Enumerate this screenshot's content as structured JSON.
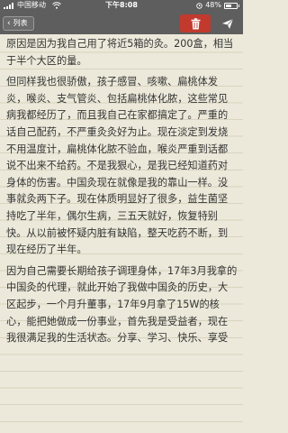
{
  "status_bar": {
    "carrier": "中国移动",
    "time": "下午8:08",
    "battery": "48%"
  },
  "nav": {
    "back_label": "列表",
    "back_icon": "chevron-left-icon",
    "delete_icon": "trash-icon",
    "share_icon": "send-icon"
  },
  "colors": {
    "toolbar": "#5e5e5e",
    "delete": "#c23a2e",
    "paper": "#ece9da"
  },
  "note": {
    "paragraphs": [
      "原因是因为我自己用了将近5箱的灸。200盒，相当于半个大区的量。",
      "但同样我也很骄傲，孩子感冒、咳嗽、扁桃体发炎，喉炎、支气管炎、包括扁桃体化脓，这些常见病我都经历了，而且我自己在家都搞定了。严重的话自己配药，不严重灸灸好为止。现在淡定到发烧不用温度计，扁桃体化脓不验血，喉炎严重到话都说不出来不给药。不是我狠心，是我已经知道药对身体的伤害。中国灸现在就像是我的靠山一样。没事就灸两下子。现在体质明显好了很多，益生菌坚持吃了半年，偶尔生病，三五天就好，恢复特别快。从以前被怀疑内脏有缺陷，整天吃药不断，到现在经历了半年。",
      "因为自己需要长期给孩子调理身体，17年3月我拿的中国灸的代理，就此开始了我做中国灸的历史，大区起步，一个月升董事，17年9月拿了15W的核心，能把她做成一份事业，首先我是受益者，现在我很满足我的生活状态。分享、学习、快乐、享受"
    ]
  }
}
